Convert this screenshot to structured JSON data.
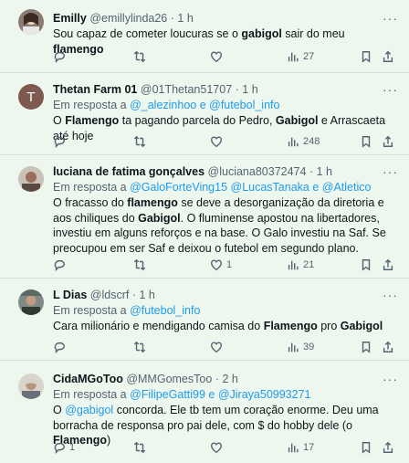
{
  "tweets": [
    {
      "name": "Emilly",
      "handle": "@emillylinda26",
      "time": "1 h",
      "reply_prefix": "",
      "reply_mentions": "",
      "body": [
        {
          "t": "Sou capaz de cometer loucuras se o "
        },
        {
          "t": "gabigol",
          "b": true
        },
        {
          "t": " sair do meu "
        },
        {
          "t": "flamengo",
          "b": true
        }
      ],
      "replies": "",
      "retweets": "",
      "likes": "",
      "views": "27"
    },
    {
      "name": "Thetan Farm 01",
      "handle": "@01Thetan51707",
      "time": "1 h",
      "avatar_letter": "T",
      "reply_prefix": "Em resposta a ",
      "reply_mentions": "@_alezinhoo e @futebol_info",
      "body": [
        {
          "t": "O "
        },
        {
          "t": "Flamengo",
          "b": true
        },
        {
          "t": " ta pagando parcela do Pedro, "
        },
        {
          "t": "Gabigol",
          "b": true
        },
        {
          "t": " e Arrascaeta até hoje"
        }
      ],
      "replies": "",
      "retweets": "",
      "likes": "",
      "views": "248"
    },
    {
      "name": "luciana de fatima gonçalves",
      "handle": "@luciana80372474",
      "time": "1 h",
      "reply_prefix": "Em resposta a ",
      "reply_mentions": "@GaloForteVing15 @LucasTanaka e @Atletico",
      "body": [
        {
          "t": "O fracasso do "
        },
        {
          "t": "flamengo",
          "b": true
        },
        {
          "t": " se deve a desorganização da diretoria e aos chiliques do "
        },
        {
          "t": "Gabigol",
          "b": true
        },
        {
          "t": ". O fluminense apostou na libertadores, investiu em alguns reforços e na base. O Galo investiu na Saf.  Se preocupou em ser Saf e deixou o futebol em segundo plano."
        }
      ],
      "replies": "",
      "retweets": "",
      "likes": "1",
      "views": "21"
    },
    {
      "name": "L Dias",
      "handle": "@ldscrf",
      "time": "1 h",
      "reply_prefix": "Em resposta a ",
      "reply_mentions": "@futebol_info",
      "body": [
        {
          "t": "Cara milionário e mendigando camisa do "
        },
        {
          "t": "Flamengo",
          "b": true
        },
        {
          "t": " pro "
        },
        {
          "t": "Gabigol",
          "b": true
        }
      ],
      "replies": "",
      "retweets": "",
      "likes": "",
      "views": "39"
    },
    {
      "name": "CidaMGoToo",
      "handle": "@MMGomesToo",
      "time": "2 h",
      "reply_prefix": "Em resposta a ",
      "reply_mentions": "@FilipeGatti99 e @Jiraya50993271",
      "body": [
        {
          "t": "O "
        },
        {
          "t": "@gabigol",
          "m": true
        },
        {
          "t": " concorda. Ele tb tem um coração enorme. Deu uma borracha de responsa pro pai dele, com $ do hobby dele (o "
        },
        {
          "t": "Flamengo",
          "b": true
        },
        {
          "t": ")"
        }
      ],
      "replies": "1",
      "retweets": "",
      "likes": "",
      "views": "17"
    }
  ],
  "icons": {
    "reply": "reply-icon",
    "retweet": "retweet-icon",
    "like": "heart-icon",
    "views": "views-icon",
    "bookmark": "bookmark-icon",
    "share": "share-icon",
    "more": "more-icon"
  },
  "colors": {
    "background": "#eef7ee",
    "link": "#1d9bf0",
    "secondary_text": "#536471"
  }
}
